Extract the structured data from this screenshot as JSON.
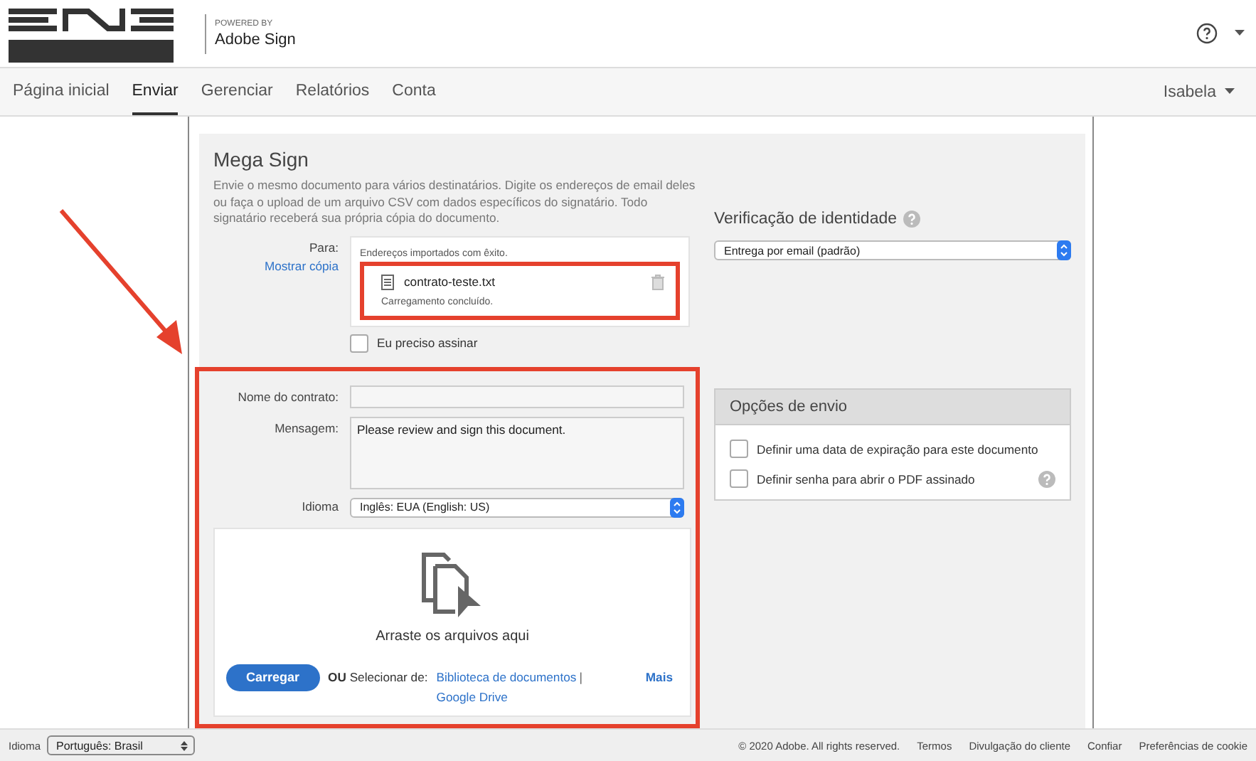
{
  "header": {
    "powered_by": "POWERED BY",
    "product": "Adobe Sign"
  },
  "nav": {
    "tabs": [
      {
        "label": "Página inicial",
        "selected": false
      },
      {
        "label": "Enviar",
        "selected": true
      },
      {
        "label": "Gerenciar",
        "selected": false
      },
      {
        "label": "Relatórios",
        "selected": false
      },
      {
        "label": "Conta",
        "selected": false
      }
    ],
    "user": "Isabela"
  },
  "mega_sign": {
    "title": "Mega Sign",
    "description": "Envie o mesmo documento para vários destinatários. Digite os endereços de email deles ou faça o upload de um arquivo CSV com dados específicos do signatário. Todo signatário receberá sua própria cópia do documento.",
    "to_label": "Para:",
    "show_copy": "Mostrar cópia",
    "import_status": "Endereços importados com êxito.",
    "file": {
      "name": "contrato-teste.txt",
      "status": "Carregamento concluído."
    },
    "sign_checkbox": {
      "label": "Eu preciso assinar",
      "checked": false
    },
    "contract_name": {
      "label": "Nome do contrato:"
    },
    "message": {
      "label": "Mensagem:",
      "value": "Please review and sign this document."
    },
    "language": {
      "label": "Idioma",
      "value": "Inglês: EUA (English: US)"
    },
    "dropzone": {
      "text": "Arraste os arquivos aqui",
      "upload_button": "Carregar",
      "or": "OU",
      "select_from": "Selecionar de:",
      "sources": [
        "Biblioteca de documentos",
        "Google Drive"
      ],
      "separator": "|",
      "more": "Mais"
    }
  },
  "identity": {
    "title": "Verificação de identidade",
    "value": "Entrega por email (padrão)"
  },
  "send_options": {
    "title": "Opções de envio",
    "options": [
      {
        "label": "Definir uma data de expiração para este documento",
        "checked": false,
        "help": false
      },
      {
        "label": "Definir senha para abrir o PDF assinado",
        "checked": false,
        "help": true
      }
    ]
  },
  "footer": {
    "language_label": "Idioma",
    "language": "Português: Brasil",
    "copyright": "© 2020 Adobe. All rights reserved.",
    "links": [
      "Termos",
      "Divulgação do cliente",
      "Confiar",
      "Preferências de cookie"
    ]
  }
}
